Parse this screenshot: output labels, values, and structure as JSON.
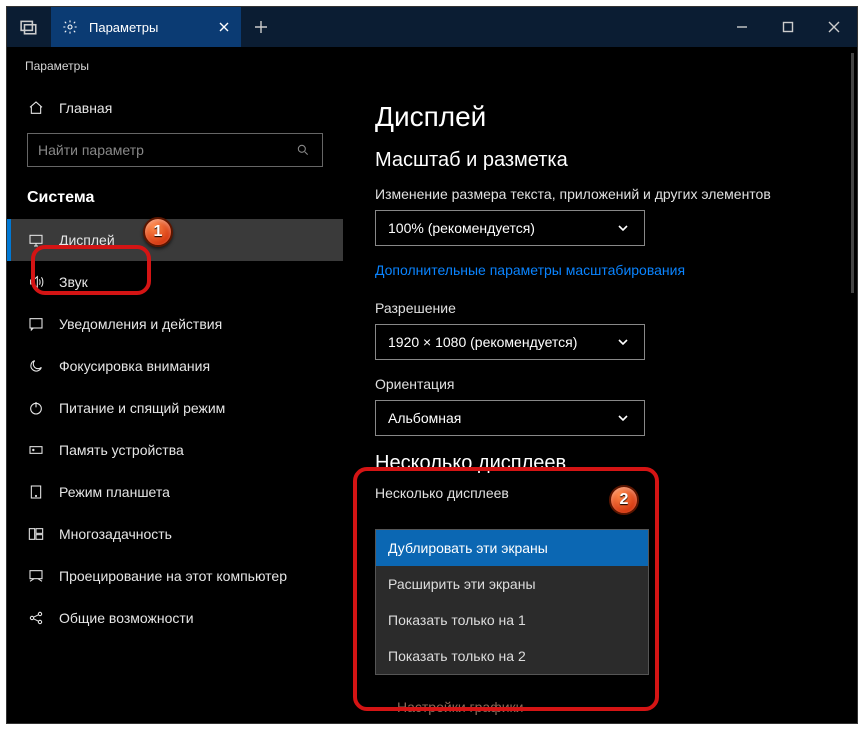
{
  "titlebar": {
    "tab_label": "Параметры",
    "app_title": "Параметры"
  },
  "sidebar": {
    "home": "Главная",
    "search_placeholder": "Найти параметр",
    "category": "Система",
    "items": [
      {
        "label": "Дисплей"
      },
      {
        "label": "Звук"
      },
      {
        "label": "Уведомления и действия"
      },
      {
        "label": "Фокусировка внимания"
      },
      {
        "label": "Питание и спящий режим"
      },
      {
        "label": "Память устройства"
      },
      {
        "label": "Режим планшета"
      },
      {
        "label": "Многозадачность"
      },
      {
        "label": "Проецирование на этот компьютер"
      },
      {
        "label": "Общие возможности"
      }
    ]
  },
  "main": {
    "title": "Дисплей",
    "scale_heading": "Масштаб и разметка",
    "scale_label": "Изменение размера текста, приложений и других элементов",
    "scale_value": "100% (рекомендуется)",
    "scale_link": "Дополнительные параметры масштабирования",
    "resolution_label": "Разрешение",
    "resolution_value": "1920 × 1080 (рекомендуется)",
    "orientation_label": "Ориентация",
    "orientation_value": "Альбомная",
    "multi_heading": "Несколько дисплеев",
    "multi_label": "Несколько дисплеев",
    "multi_options": [
      "Дублировать эти экраны",
      "Расширить эти экраны",
      "Показать только на 1",
      "Показать только на 2"
    ],
    "graphics_link": "Настройки графики"
  },
  "annotations": {
    "b1": "1",
    "b2": "2"
  }
}
